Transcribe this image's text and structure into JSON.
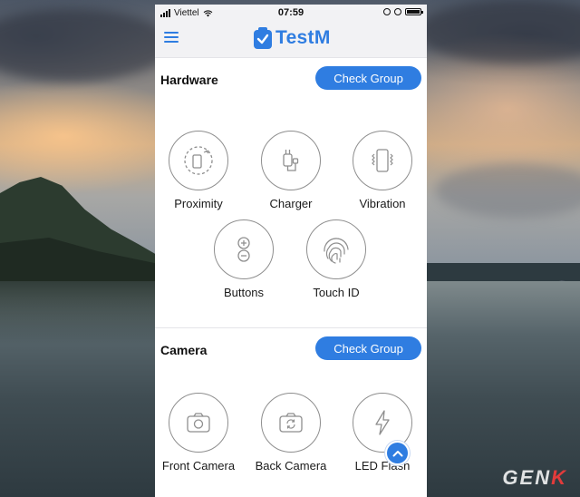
{
  "status_bar": {
    "carrier": "Viettel",
    "time": "07:59"
  },
  "app": {
    "name": "TestM"
  },
  "sections": [
    {
      "title": "Hardware",
      "button": "Check Group",
      "items": [
        "Proximity",
        "Charger",
        "Vibration",
        "Buttons",
        "Touch ID"
      ]
    },
    {
      "title": "Camera",
      "button": "Check Group",
      "items": [
        "Front Camera",
        "Back Camera",
        "LED Flash"
      ]
    }
  ],
  "icons": {
    "menu": "hamburger-icon",
    "proximity": "proximity-sensor-icon",
    "charger": "charger-plug-icon",
    "vibration": "vibrating-phone-icon",
    "buttons": "plus-minus-buttons-icon",
    "touch_id": "fingerprint-icon",
    "front_camera": "camera-icon",
    "back_camera": "camera-rotate-icon",
    "led_flash": "lightning-icon",
    "scroll_top": "chevron-up-icon"
  },
  "watermark": {
    "prefix": "GEN",
    "suffix": "K"
  },
  "colors": {
    "accent": "#2f7de1",
    "header_bg": "#f2f2f4",
    "icon_stroke": "#8e8e8e"
  }
}
